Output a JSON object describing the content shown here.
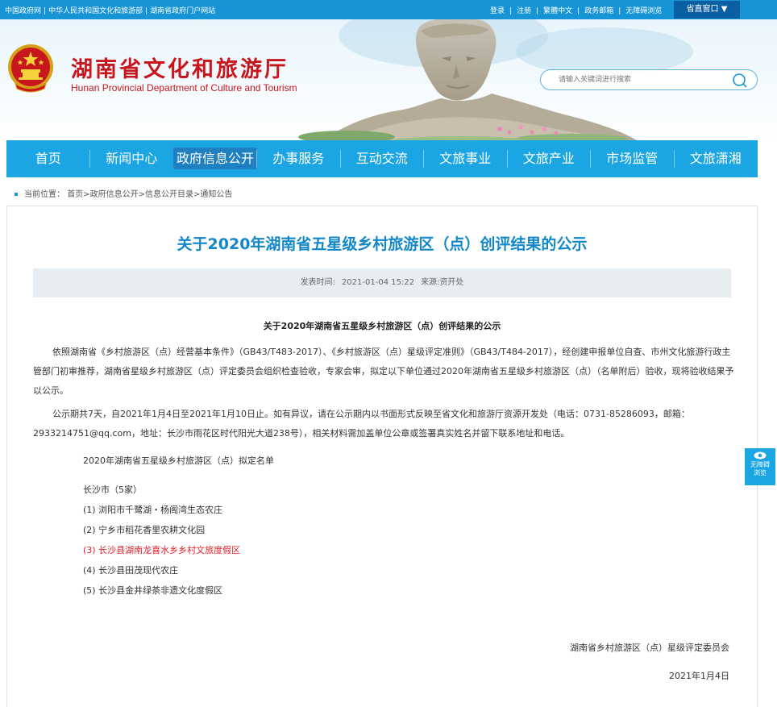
{
  "topbar": {
    "left_links": [
      "中国政府网",
      "中华人民共和国文化和旅游部",
      "湖南省政府门户网站"
    ],
    "right_links": [
      "登录",
      "注册",
      "繁體中文",
      "政务邮箱",
      "无障碍浏览"
    ],
    "portal_label": "省直窗口 ▼"
  },
  "header": {
    "site_title": "湖南省文化和旅游厅",
    "site_subtitle": "Hunan Provincial Department of Culture and Tourism",
    "search_placeholder": "请输入关键词进行搜索"
  },
  "nav": {
    "items": [
      "首页",
      "新闻中心",
      "政府信息公开",
      "办事服务",
      "互动交流",
      "文旅事业",
      "文旅产业",
      "市场监管",
      "文旅潇湘"
    ],
    "active_index": 2
  },
  "breadcrumb": {
    "label": "当前位置：",
    "path": "首页>政府信息公开>信息公开目录>通知公告"
  },
  "article": {
    "title": "关于2020年湖南省五星级乡村旅游区（点）创评结果的公示",
    "publish_label": "发表时间:",
    "publish_time": "2021-01-04 15:22",
    "source": "来源:资开处",
    "body_title": "关于2020年湖南省五星级乡村旅游区（点）创评结果的公示",
    "paragraph1": "依照湖南省《乡村旅游区（点）经营基本条件》（GB43/T483-2017）、《乡村旅游区（点）星级评定准则》（GB43/T484-2017），经创建申报单位自查、市州文化旅游行政主管部门初审推荐，湖南省星级乡村旅游区（点）评定委员会组织检查验收，专家会审，拟定以下单位通过2020年湖南省五星级乡村旅游区（点）（名单附后）验收，现将验收结果予以公示。",
    "paragraph2": "公示期共7天，自2021年1月4日至2021年1月10日止。如有异议，请在公示期内以书面形式反映至省文化和旅游厅资源开发处（电话：0731-85286093，邮箱：2933214751@qq.com，地址：长沙市雨花区时代阳光大道238号），相关材料需加盖单位公章或签署真实姓名并留下联系地址和电话。",
    "list_heading": "2020年湖南省五星级乡村旅游区（点）拟定名单",
    "city": "长沙市（5家）",
    "items": [
      "(1) 浏阳市千鹭湖・杨阁湾生态农庄",
      "(2) 宁乡市稻花香里农耕文化园",
      "(3) 长沙县湖南龙喜水乡乡村文旅度假区",
      "(4) 长沙县田茂现代农庄",
      "(5) 长沙县金井绿茶非遗文化度假区"
    ],
    "highlight_index": 2,
    "signature": "湖南省乡村旅游区（点）星级评定委员会",
    "date": "2021年1月4日"
  },
  "float_accessibility": {
    "line1": "无障碍",
    "line2": "浏览"
  },
  "colors": {
    "topbar": "#1794d6",
    "nav": "#1ba5e3",
    "nav_active": "#1e7fc1",
    "title_red": "#c8161d",
    "article_title": "#1287c9",
    "highlight": "#e0212a"
  }
}
